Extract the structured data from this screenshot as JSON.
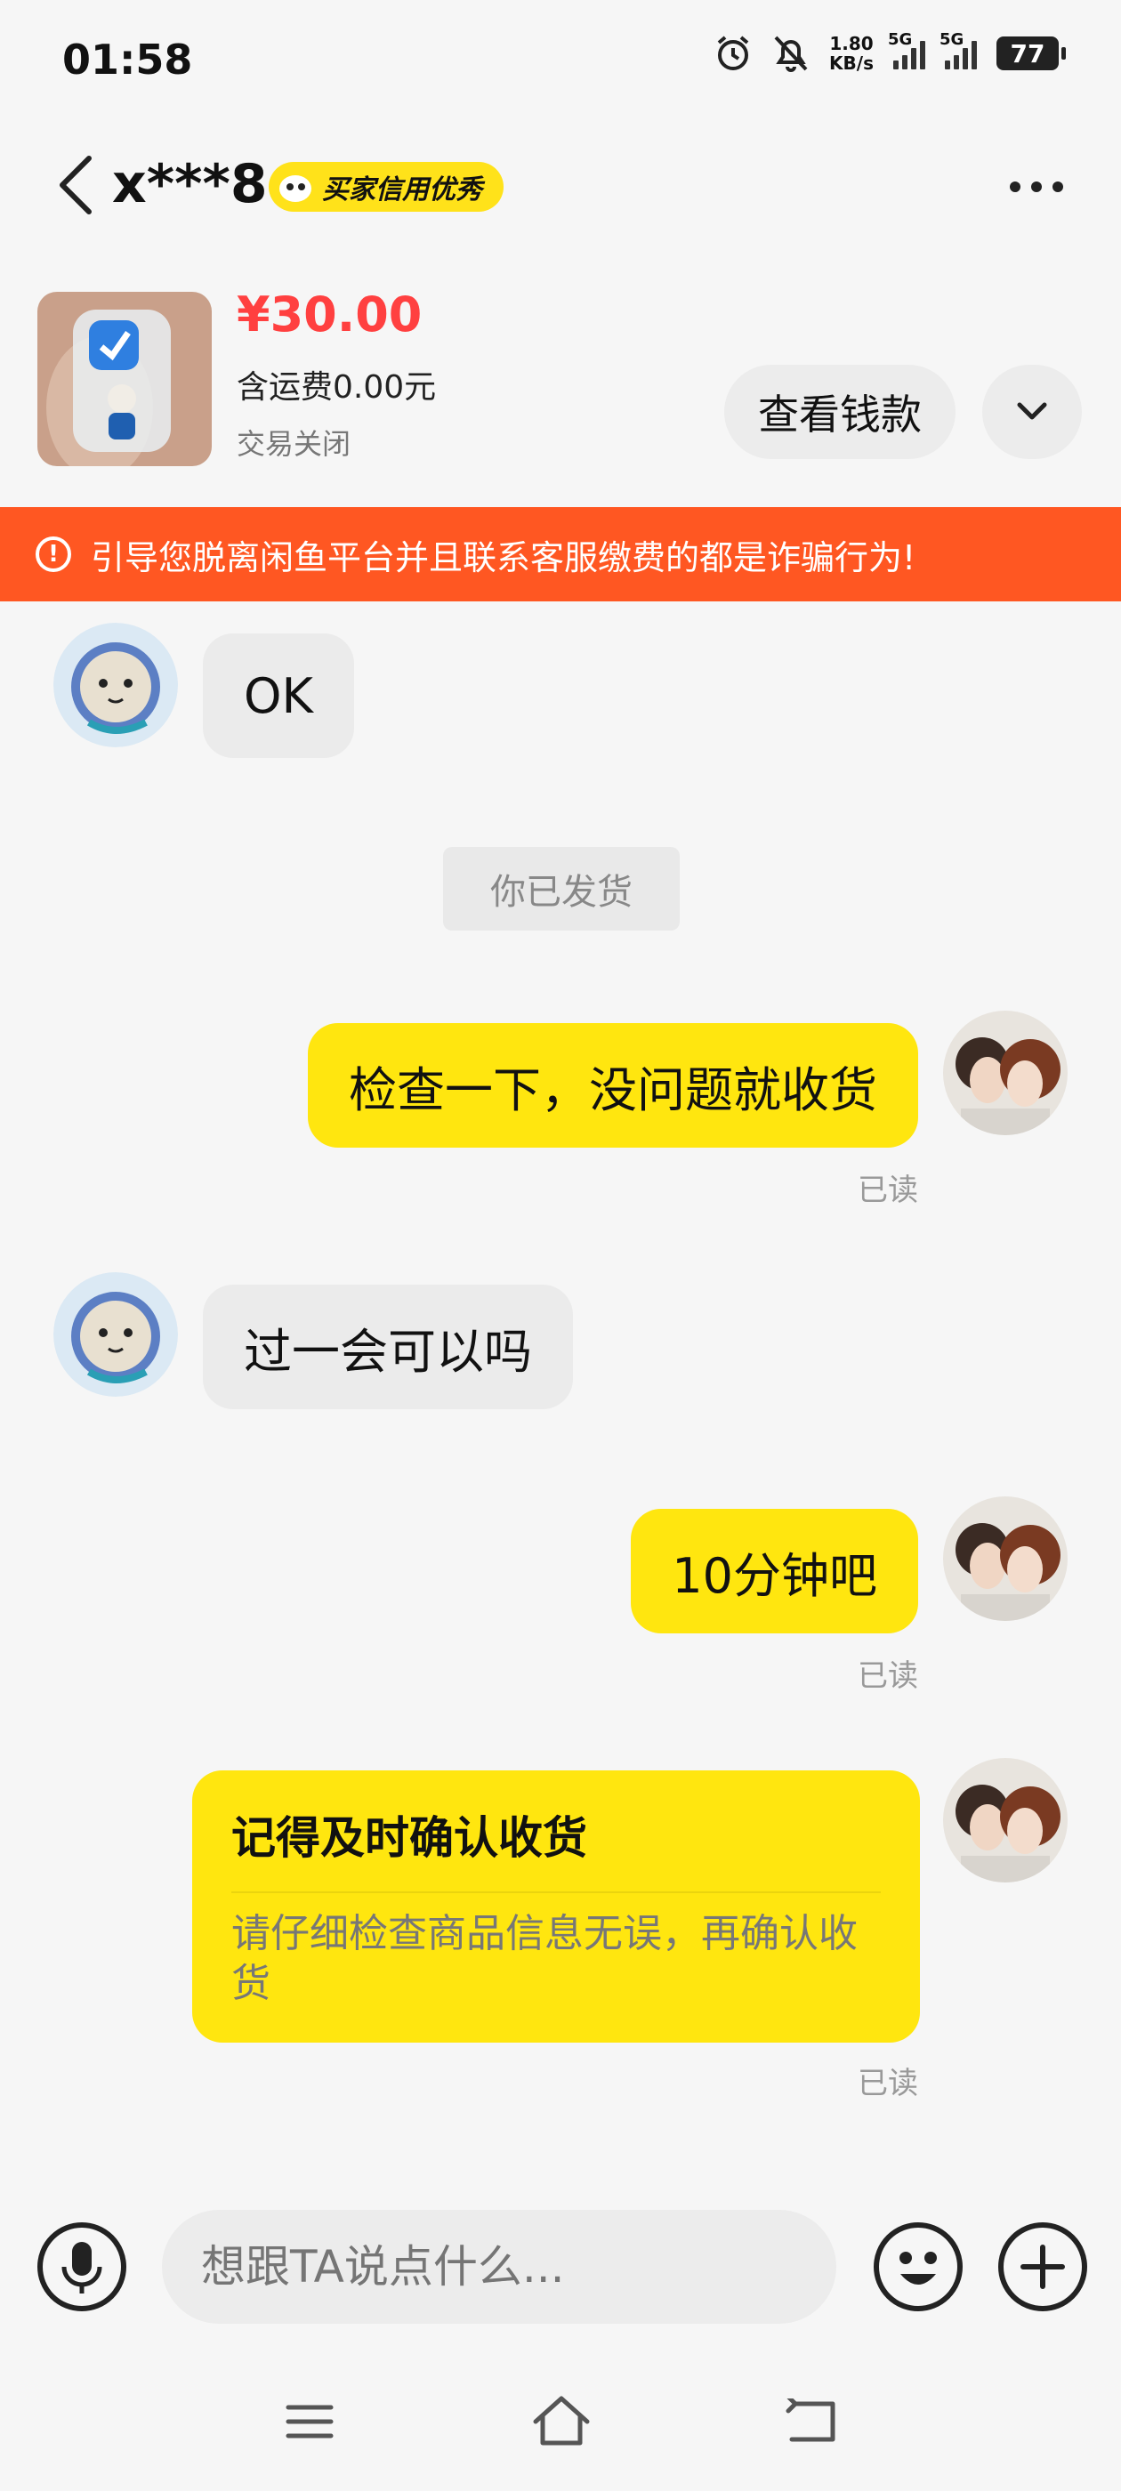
{
  "status_bar": {
    "time": "01:58",
    "net_speed_value": "1.80",
    "net_speed_unit": "KB/s",
    "signal1_label": "5G",
    "signal2_label": "5G",
    "battery": "77",
    "icons": [
      "alarm-icon",
      "bell-muted-icon"
    ]
  },
  "header": {
    "username": "x***8",
    "credit_badge": "买家信用优秀"
  },
  "product": {
    "price": "¥30.00",
    "shipping": "含运费0.00元",
    "status": "交易关闭",
    "view_payment_label": "查看钱款"
  },
  "warning": {
    "text": "引导您脱离闲鱼平台并且联系客服缴费的都是诈骗行为!"
  },
  "messages": {
    "m1": "OK",
    "system": "你已发货",
    "m2": "检查一下，没问题就收货",
    "m2_status": "已读",
    "m3": "过一会可以吗",
    "m4": "10分钟吧",
    "m4_status": "已读",
    "card_title": "记得及时确认收货",
    "card_body": "请仔细检查商品信息无误，再确认收货",
    "card_status": "已读"
  },
  "input": {
    "placeholder": "想跟TA说点什么..."
  },
  "colors": {
    "accent_yellow": "#ffe60f",
    "warning_orange": "#ff5722",
    "price_red": "#ff4040"
  }
}
